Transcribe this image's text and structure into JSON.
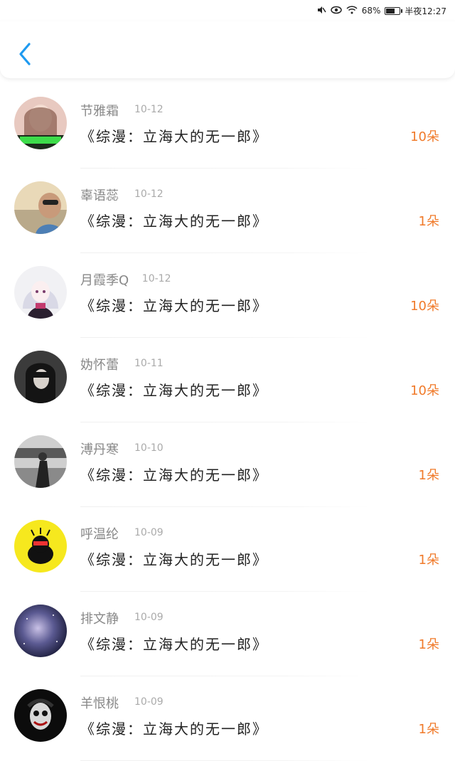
{
  "status_bar": {
    "battery": "68%",
    "battery_level": 0.68,
    "time": "半夜12:27"
  },
  "header": {
    "back_icon": "chevron-left-icon",
    "accent_color": "#1e9af0"
  },
  "list": {
    "items": [
      {
        "name": "节雅霜",
        "date": "10-12",
        "title": "《综漫：立海大的无一郎》",
        "amount": "10朵",
        "avatar": "photo-girl"
      },
      {
        "name": "辜语蕊",
        "date": "10-12",
        "title": "《综漫：立海大的无一郎》",
        "amount": "1朵",
        "avatar": "photo-selfie"
      },
      {
        "name": "月霞季Q",
        "date": "10-12",
        "title": "《综漫：立海大的无一郎》",
        "amount": "10朵",
        "avatar": "anime-girl"
      },
      {
        "name": "妫怀蕾",
        "date": "10-11",
        "title": "《综漫：立海大的无一郎》",
        "amount": "10朵",
        "avatar": "dark-girl"
      },
      {
        "name": "溥丹寒",
        "date": "10-10",
        "title": "《综漫：立海大的无一郎》",
        "amount": "1朵",
        "avatar": "bw-photo"
      },
      {
        "name": "呼温纶",
        "date": "10-09",
        "title": "《综漫：立海大的无一郎》",
        "amount": "1朵",
        "avatar": "yellow-bear"
      },
      {
        "name": "排文静",
        "date": "10-09",
        "title": "《综漫：立海大的无一郎》",
        "amount": "1朵",
        "avatar": "galaxy"
      },
      {
        "name": "羊恨桃",
        "date": "10-09",
        "title": "《综漫：立海大的无一郎》",
        "amount": "1朵",
        "avatar": "joker"
      }
    ]
  },
  "colors": {
    "amount": "#f07a2a",
    "name": "#888888",
    "title": "#222222"
  }
}
